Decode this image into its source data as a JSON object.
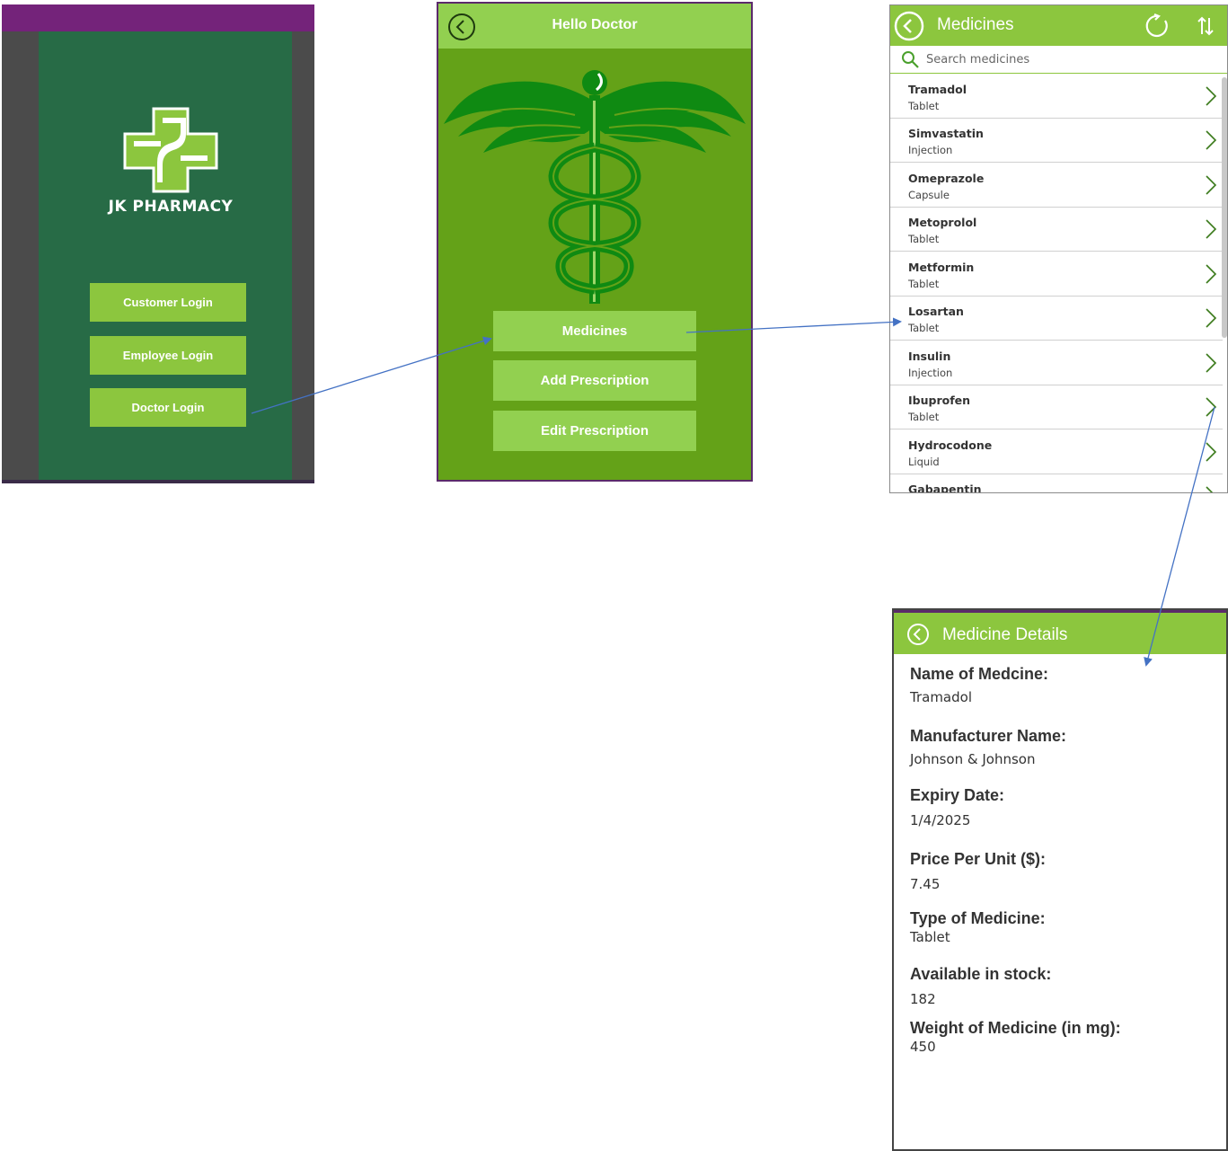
{
  "login": {
    "brand": "JK PHARMACY",
    "buttons": {
      "customer": "Customer Login",
      "employee": "Employee Login",
      "doctor": "Doctor Login"
    }
  },
  "doctor": {
    "title": "Hello Doctor",
    "buttons": {
      "medicines": "Medicines",
      "add_prescription": "Add Prescription",
      "edit_prescription": "Edit Prescription"
    }
  },
  "medicines": {
    "title": "Medicines",
    "search_placeholder": "Search medicines",
    "items": [
      {
        "name": "Tramadol",
        "type": "Tablet"
      },
      {
        "name": "Simvastatin",
        "type": "Injection"
      },
      {
        "name": "Omeprazole",
        "type": "Capsule"
      },
      {
        "name": "Metoprolol",
        "type": "Tablet"
      },
      {
        "name": "Metformin",
        "type": "Tablet"
      },
      {
        "name": "Losartan",
        "type": "Tablet"
      },
      {
        "name": "Insulin",
        "type": "Injection"
      },
      {
        "name": "Ibuprofen",
        "type": "Tablet"
      },
      {
        "name": "Hydrocodone",
        "type": "Liquid"
      },
      {
        "name": "Gabapentin",
        "type": ""
      }
    ]
  },
  "details": {
    "title": "Medicine Details",
    "fields": [
      {
        "label": "Name of Medcine:",
        "value": "Tramadol"
      },
      {
        "label": "Manufacturer Name:",
        "value": "Johnson & Johnson"
      },
      {
        "label": "Expiry Date:",
        "value": "1/4/2025"
      },
      {
        "label": "Price Per Unit ($):",
        "value": "7.45"
      },
      {
        "label": "Type of Medicine:",
        "value": "Tablet"
      },
      {
        "label": "Available in stock:",
        "value": "182"
      },
      {
        "label": "Weight of Medicine (in mg):",
        "value": "450"
      }
    ]
  },
  "colors": {
    "accent_green": "#8cc63e",
    "panel_green": "#276b46",
    "doctor_bg": "#64a218",
    "purple_bar": "#74237a",
    "arrow_blue": "#4472c4"
  }
}
